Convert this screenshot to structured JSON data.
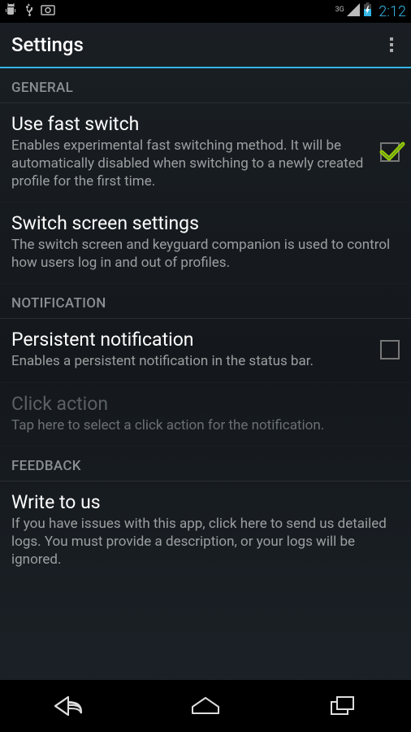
{
  "status": {
    "time": "2:12",
    "net_label": "3G"
  },
  "appbar": {
    "title": "Settings"
  },
  "sections": {
    "general": {
      "header": "GENERAL",
      "items": [
        {
          "title": "Use fast switch",
          "subtitle": "Enables experimental fast switching method. It will be automatically disabled when switching to a newly created profile for the first time.",
          "checked": true
        },
        {
          "title": "Switch screen settings",
          "subtitle": "The switch screen and keyguard companion is used to control how users log in and out of profiles."
        }
      ]
    },
    "notification": {
      "header": "NOTIFICATION",
      "items": [
        {
          "title": "Persistent notification",
          "subtitle": "Enables a persistent notification in the status bar.",
          "checked": false
        },
        {
          "title": "Click action",
          "subtitle": "Tap here to select a click action for the notification.",
          "disabled": true
        }
      ]
    },
    "feedback": {
      "header": "FEEDBACK",
      "items": [
        {
          "title": "Write to us",
          "subtitle": "If you have issues with this app, click here to send us detailed logs. You must provide a description, or your logs will be ignored."
        }
      ]
    }
  }
}
